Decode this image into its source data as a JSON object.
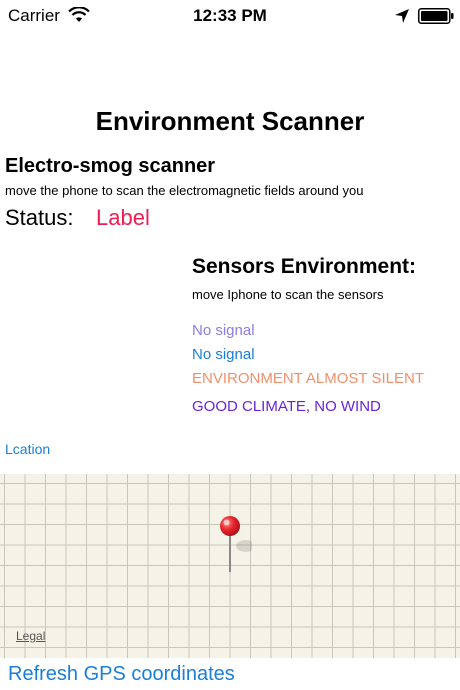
{
  "status_bar": {
    "carrier": "Carrier",
    "time": "12:33 PM",
    "icons": [
      "wifi-icon",
      "location-arrow-icon",
      "battery-icon"
    ]
  },
  "title": "Environment Scanner",
  "smog": {
    "heading": "Electro-smog scanner",
    "description": "move the phone to scan the electromagnetic fields around you",
    "status_label": "Status:",
    "status_value": "Label"
  },
  "sensors": {
    "heading": "Sensors Environment:",
    "description": "move Iphone to scan the sensors",
    "signal_1": "No signal",
    "signal_2": "No signal",
    "noise": "ENVIRONMENT ALMOST SILENT",
    "climate": "GOOD CLIMATE, NO WIND"
  },
  "location_label": "Lcation",
  "map": {
    "legal": "Legal",
    "pin_color": "#e8262b"
  },
  "refresh_button": "Refresh GPS coordinates",
  "colors": {
    "status_value": "#f01c52",
    "link_blue": "#1a7fd8",
    "signal_1": "#8b7ee0",
    "noise": "#f0906c",
    "climate": "#6a24d8"
  }
}
